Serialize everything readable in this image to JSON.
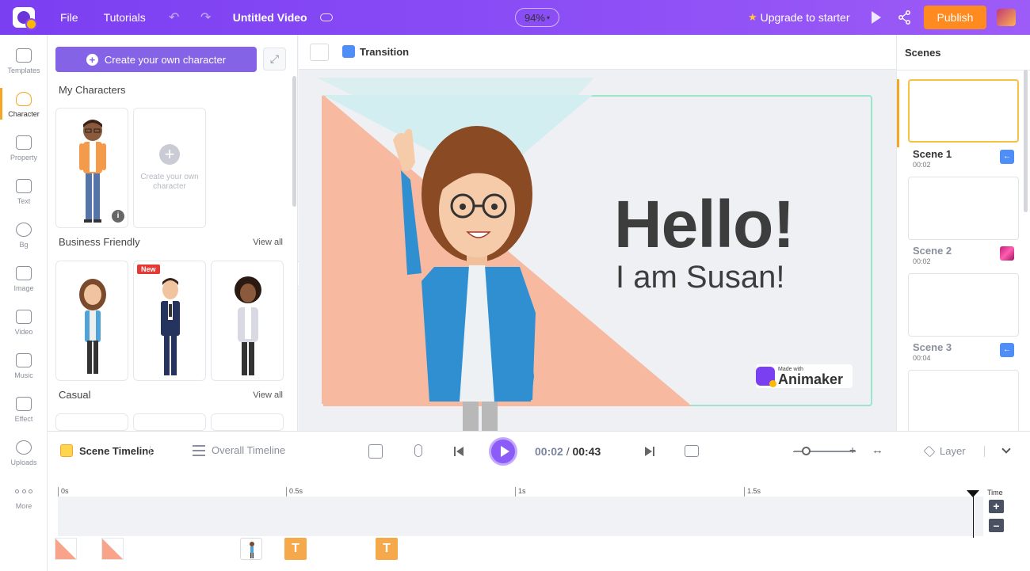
{
  "topbar": {
    "menu": [
      {
        "label": "File"
      },
      {
        "label": "Tutorials"
      }
    ],
    "title": "Untitled Video",
    "zoom": "94%",
    "upgrade": "Upgrade to starter",
    "publish": "Publish"
  },
  "rail": [
    {
      "label": "Templates",
      "icon": "templates-icon"
    },
    {
      "label": "Character",
      "icon": "character-icon",
      "active": true
    },
    {
      "label": "Property",
      "icon": "property-icon"
    },
    {
      "label": "Text",
      "icon": "text-icon"
    },
    {
      "label": "Bg",
      "icon": "bg-icon"
    },
    {
      "label": "Image",
      "icon": "image-icon"
    },
    {
      "label": "Video",
      "icon": "video-icon"
    },
    {
      "label": "Music",
      "icon": "music-icon"
    },
    {
      "label": "Effect",
      "icon": "effect-icon"
    },
    {
      "label": "Uploads",
      "icon": "uploads-icon"
    },
    {
      "label": "More",
      "icon": "more-icon"
    }
  ],
  "panel": {
    "create_label": "Create your own character",
    "my_characters": "My Characters",
    "empty_card_label": "Create your own character",
    "business": "Business Friendly",
    "casual": "Casual",
    "view_all": "View all",
    "new_badge": "New"
  },
  "canvas": {
    "transition": "Transition",
    "hello": "Hello!",
    "subline": "I am Susan!",
    "made_with": "Made with",
    "brand": "Animaker"
  },
  "scenes": {
    "title": "Scenes",
    "items": [
      {
        "name": "Scene 1",
        "duration": "00:02"
      },
      {
        "name": "Scene 2",
        "duration": "00:02"
      },
      {
        "name": "Scene 3",
        "duration": "00:04"
      }
    ]
  },
  "timeline": {
    "scene_tab": "Scene Timeline",
    "overall_tab": "Overall Timeline",
    "current": "00:02",
    "separator": "/",
    "total": "00:43",
    "layer": "Layer",
    "ticks": [
      "0s",
      "0.5s",
      "1s",
      "1.5s"
    ],
    "time_label": "Time",
    "text_item": "T"
  },
  "colors": {
    "accent": "#7b3ff2",
    "publish": "#ff8a1f",
    "stage_peach": "#f7b9a0",
    "stage_teal": "#d3eef0",
    "character_active": "#f5a623"
  }
}
